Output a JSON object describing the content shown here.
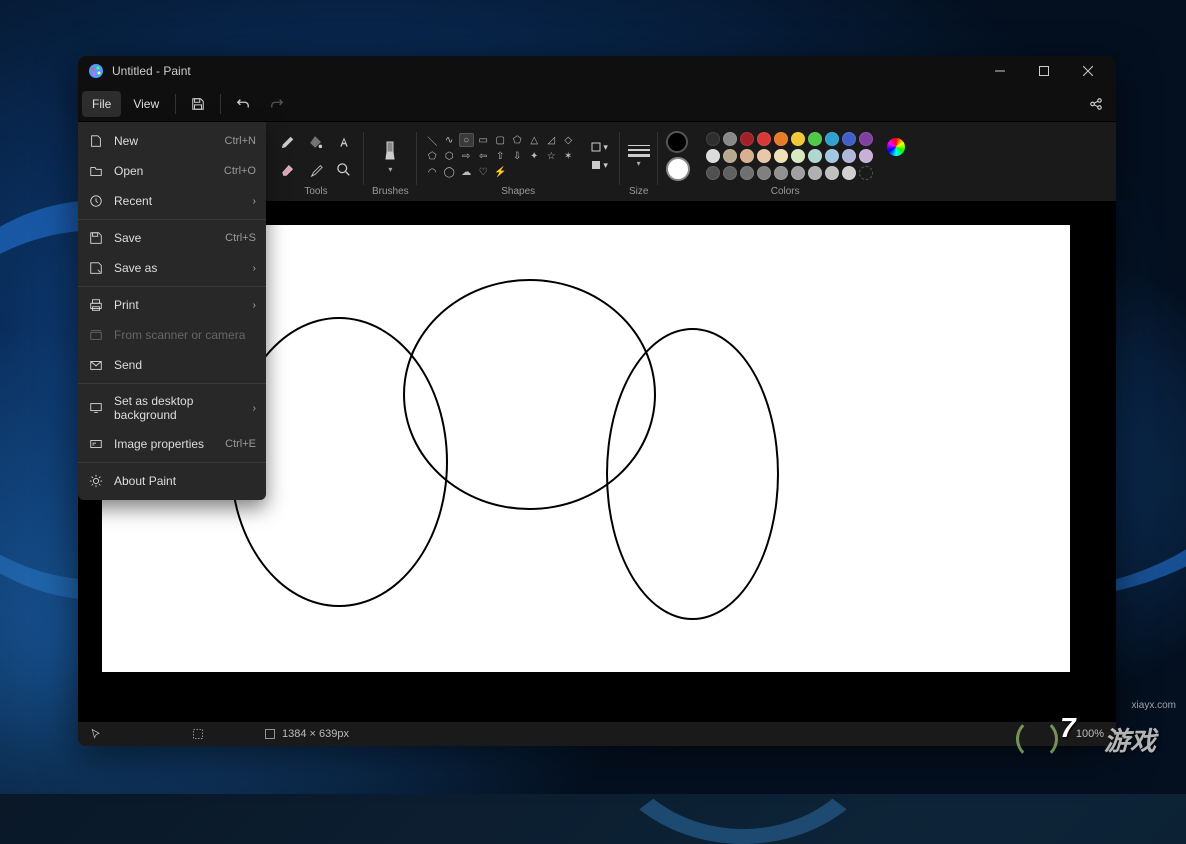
{
  "window": {
    "title": "Untitled - Paint"
  },
  "menubar": {
    "file": "File",
    "view": "View"
  },
  "file_menu": {
    "new": "New",
    "new_accel": "Ctrl+N",
    "open": "Open",
    "open_accel": "Ctrl+O",
    "recent": "Recent",
    "save": "Save",
    "save_accel": "Ctrl+S",
    "save_as": "Save as",
    "print": "Print",
    "scanner": "From scanner or camera",
    "send": "Send",
    "set_bg": "Set as desktop background",
    "props": "Image properties",
    "props_accel": "Ctrl+E",
    "about": "About Paint"
  },
  "ribbon": {
    "tools": "Tools",
    "brushes": "Brushes",
    "shapes": "Shapes",
    "size": "Size",
    "colors": "Colors"
  },
  "palette_row1": [
    "#2e2e2e",
    "#888888",
    "#a0202c",
    "#d83838",
    "#e67c28",
    "#f0c838",
    "#50c848",
    "#30a0d0",
    "#4060c8",
    "#8040a0"
  ],
  "palette_row2": [
    "#dcdcdc",
    "#b8a890",
    "#d8b090",
    "#e8c8a8",
    "#f0e0b8",
    "#d8e8c0",
    "#b0d8d0",
    "#a0c8e0",
    "#b0b8d8",
    "#c8b0d8"
  ],
  "palette_row3": [
    "#505050",
    "#606060",
    "#707070",
    "#808080",
    "#909090",
    "#a0a0a0",
    "#b0b0b0",
    "#c0c0c0",
    "#d0d0d0",
    ""
  ],
  "primary_color": "#000000",
  "secondary_color": "#ffffff",
  "statusbar": {
    "dimensions": "1384 × 639px",
    "zoom": "100%"
  },
  "watermark": {
    "main": "游戏",
    "sub": "xiayx.com",
    "prefix": "7"
  }
}
